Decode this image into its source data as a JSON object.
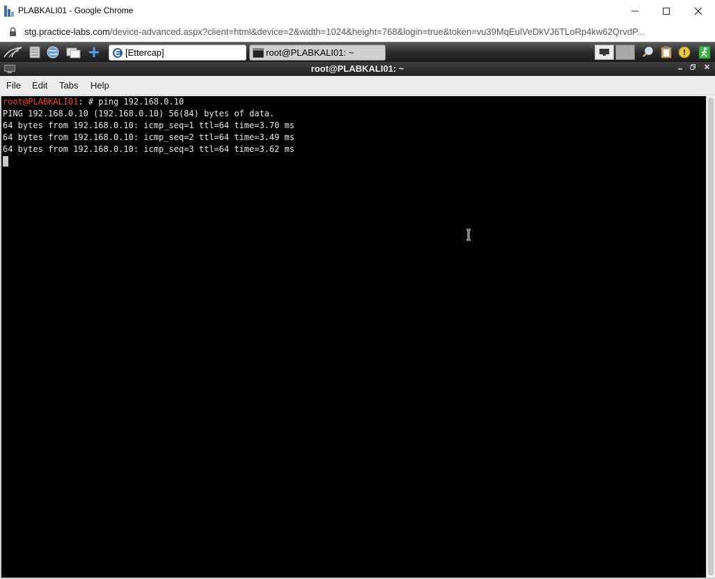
{
  "browser": {
    "window_title": "PLABKALI01 - Google Chrome",
    "url_host": "stg.practice-labs.com",
    "url_path": "/device-advanced.aspx?client=html&device=2&width=1024&height=768&login=true&token=vu39MqEulVeDkVJ6TLoRp4kw62QrvdP..."
  },
  "panel": {
    "tasks": [
      {
        "label": "[Ettercap]",
        "icon": "ettercap-icon"
      },
      {
        "label": "root@PLABKALI01: ~",
        "icon": "terminal-icon"
      }
    ]
  },
  "terminal": {
    "window_title": "root@PLABKALI01: ~",
    "menu": [
      "File",
      "Edit",
      "Tabs",
      "Help"
    ],
    "prompt_user": "root@PLABKALI01",
    "prompt_rest": ": # ping 192.168.0.10",
    "output": [
      "PING 192.168.0.10 (192.168.0.10) 56(84) bytes of data.",
      "64 bytes from 192.168.0.10: icmp_seq=1 ttl=64 time=3.70 ms",
      "64 bytes from 192.168.0.10: icmp_seq=2 ttl=64 time=3.49 ms",
      "64 bytes from 192.168.0.10: icmp_seq=3 ttl=64 time=3.62 ms"
    ]
  },
  "colors": {
    "terminal_bg": "#000000",
    "terminal_fg": "#e6e6e6",
    "prompt_user": "#ff3b3b"
  }
}
